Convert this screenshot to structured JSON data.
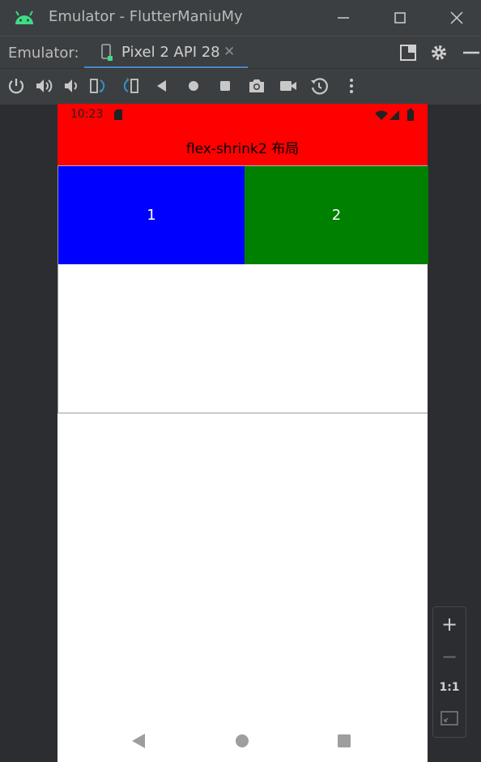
{
  "window": {
    "title": "Emulator - FlutterManiuMy",
    "minimize_label": "—",
    "maximize_label": "☐",
    "close_label": "✕"
  },
  "tabbar": {
    "label": "Emulator:",
    "active_tab": "Pixel 2 API 28",
    "tab_close": "✕"
  },
  "colors": {
    "accent": "#4a88c7",
    "android_green": "#3ddc84",
    "status_red": "#ff0000",
    "box1_blue": "#0000ff",
    "box2_green": "#008000"
  },
  "toolbar": {
    "icons": [
      "power-icon",
      "volume-up-icon",
      "volume-down-icon",
      "rotate-left-icon",
      "rotate-right-icon",
      "back-icon",
      "home-icon",
      "overview-icon",
      "screenshot-icon",
      "screen-record-icon",
      "snapshot-icon",
      "more-icon"
    ]
  },
  "phone": {
    "status_time": "10:23",
    "appbar_title": "flex-shrink2 布局",
    "box1_label": "1",
    "box2_label": "2"
  },
  "zoom": {
    "zoom_in": "+",
    "zoom_out": "−",
    "one_to_one": "1:1"
  }
}
